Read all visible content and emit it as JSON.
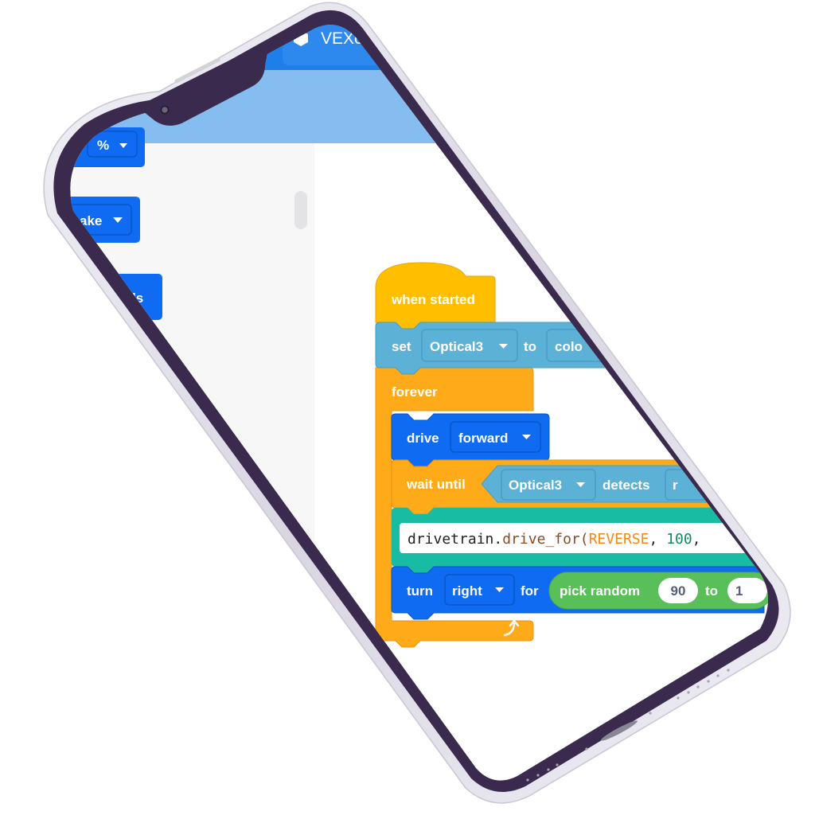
{
  "app": {
    "title": "VEXcod",
    "logo_icon": "hexagon-icon"
  },
  "colors": {
    "header_dark": "#1e7fe8",
    "header_light": "#86bdf0",
    "palette_bg": "#f7f7f8",
    "canvas_bg": "#ffffff",
    "events_yellow": "#ffbf00",
    "control_orange": "#ffab19",
    "sensing_blue": "#5cb1d6",
    "drivetrain_blue": "#0f6cf2",
    "python_teal": "#17bca3",
    "operators_green": "#59c059",
    "bezel": "#3a2a4d",
    "frame": "#e6e4ec"
  },
  "palette": {
    "blocks": [
      {
        "label": "%",
        "has_dropdown": true
      },
      {
        "label": "ake",
        "has_dropdown": true
      },
      {
        "label": "nds",
        "has_dropdown": false
      }
    ]
  },
  "script": {
    "hat": {
      "label": "when started"
    },
    "set_block": {
      "verb": "set",
      "sensor": "Optical3",
      "to": "to",
      "value": "colo"
    },
    "forever": {
      "label": "forever"
    },
    "drive": {
      "verb": "drive",
      "direction": "forward"
    },
    "wait_until": {
      "label": "wait until",
      "sensor": "Optical3",
      "detects": "detects",
      "value": "r"
    },
    "python_line": {
      "object": "drivetrain.",
      "method": "drive_for(",
      "arg1": "REVERSE",
      "sep": ", ",
      "arg2": "100",
      "tail": ","
    },
    "turn": {
      "verb": "turn",
      "direction": "right",
      "for": "for"
    },
    "pick_random": {
      "label": "pick random",
      "from": "90",
      "to_label": "to",
      "to": "1"
    },
    "loop_arrow_icon": "loop-arrow-icon"
  }
}
